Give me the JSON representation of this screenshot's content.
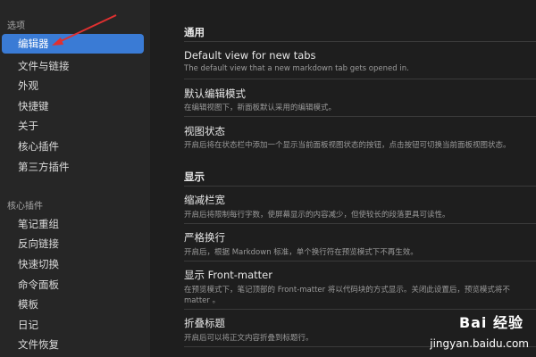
{
  "sidebar": {
    "options_header": "选项",
    "options": [
      {
        "label": "编辑器",
        "active": true
      },
      {
        "label": "文件与链接"
      },
      {
        "label": "外观"
      },
      {
        "label": "快捷键"
      },
      {
        "label": "关于"
      },
      {
        "label": "核心插件"
      },
      {
        "label": "第三方插件"
      }
    ],
    "core_plugins_header": "核心插件",
    "core_plugins": [
      {
        "label": "笔记重组"
      },
      {
        "label": "反向链接"
      },
      {
        "label": "快速切换"
      },
      {
        "label": "命令面板"
      },
      {
        "label": "模板"
      },
      {
        "label": "日记"
      },
      {
        "label": "文件恢复"
      }
    ],
    "accent_color": "#3a7bd5"
  },
  "content": {
    "groups": [
      {
        "heading": "通用",
        "settings": [
          {
            "title": "Default view for new tabs",
            "desc": "The default view that a new markdown tab gets opened in."
          },
          {
            "title": "默认编辑模式",
            "desc": "在编辑视图下，新面板默认采用的编辑模式。"
          },
          {
            "title": "视图状态",
            "desc": "开启后将在状态栏中添加一个显示当前面板视图状态的按钮，点击按钮可切换当前面板视图状态。"
          }
        ]
      },
      {
        "heading": "显示",
        "settings": [
          {
            "title": "缩减栏宽",
            "desc": "开启后将限制每行字数，使屏幕显示的内容减少，但使较长的段落更具可读性。"
          },
          {
            "title": "严格换行",
            "desc": "开启后，根据 Markdown 标准，单个换行符在预览模式下不再生效。"
          },
          {
            "title": "显示 Front-matter",
            "desc": "在预览模式下，笔记顶部的 Front-matter 将以代码块的方式显示。关闭此设置后，预览模式将不",
            "desc2": "matter 。"
          },
          {
            "title": "折叠标题",
            "desc": "开启后可以将正文内容折叠到标题行。"
          }
        ]
      }
    ]
  },
  "watermark": {
    "logo": "Bai 经验",
    "url": "jingyan.baidu.com"
  },
  "annotation": {
    "arrow_color": "#e03030"
  }
}
